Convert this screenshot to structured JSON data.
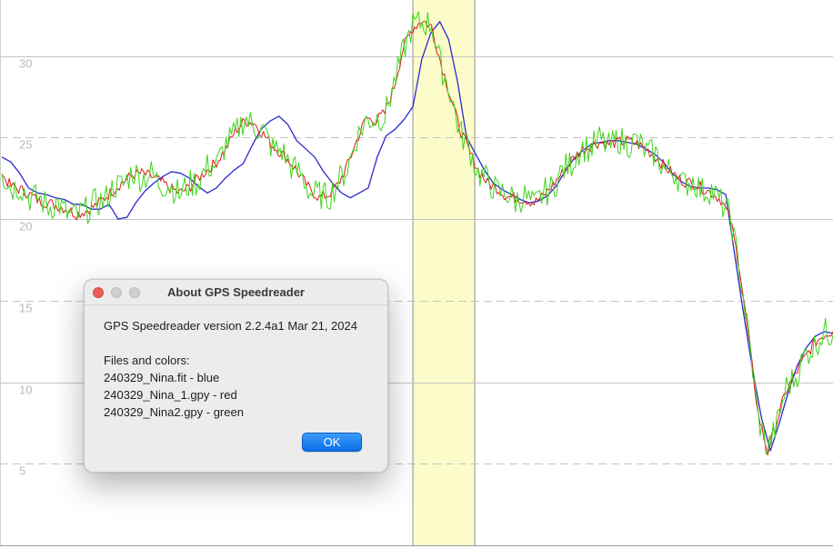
{
  "chart_data": {
    "type": "line",
    "title": "",
    "xlabel": "",
    "ylabel": "",
    "ylim": [
      0,
      33.2
    ],
    "y_ticks": [
      {
        "label": "30",
        "value": 30
      },
      {
        "label": "25",
        "value": 25
      },
      {
        "label": "20",
        "value": 20
      },
      {
        "label": "15",
        "value": 15
      },
      {
        "label": "10",
        "value": 10
      },
      {
        "label": "5",
        "value": 5
      }
    ],
    "grid": "horizontal lines; solid at 10, 20, 30 and dashed at 5, 15, 25",
    "highlighted_range": {
      "color": "#fcfccb"
    },
    "series": [
      {
        "color": "#2a2ad0",
        "points": [
          [
            0,
            23.8
          ],
          [
            1,
            23.5
          ],
          [
            2,
            22.8
          ],
          [
            3,
            21.9
          ],
          [
            4,
            21.6
          ],
          [
            5,
            21.5
          ],
          [
            6,
            21.3
          ],
          [
            7,
            21.2
          ],
          [
            8,
            20.9
          ],
          [
            9,
            20.9
          ],
          [
            10,
            20.6
          ],
          [
            11,
            20.6
          ],
          [
            12,
            20.9
          ],
          [
            13,
            20.0
          ],
          [
            14,
            20.1
          ],
          [
            15,
            21.0
          ],
          [
            16,
            21.7
          ],
          [
            17,
            22.2
          ],
          [
            18,
            22.6
          ],
          [
            19,
            22.9
          ],
          [
            20,
            22.8
          ],
          [
            21,
            22.5
          ],
          [
            22,
            22.0
          ],
          [
            23,
            21.6
          ],
          [
            24,
            21.9
          ],
          [
            25,
            22.5
          ],
          [
            26,
            23.0
          ],
          [
            27,
            23.4
          ],
          [
            28,
            24.5
          ],
          [
            29,
            25.5
          ],
          [
            30,
            26.0
          ],
          [
            31,
            26.3
          ],
          [
            32,
            25.8
          ],
          [
            33,
            24.8
          ],
          [
            34,
            24.3
          ],
          [
            35,
            23.8
          ],
          [
            36,
            22.9
          ],
          [
            37,
            22.2
          ],
          [
            38,
            21.6
          ],
          [
            39,
            21.3
          ],
          [
            40,
            21.6
          ],
          [
            41,
            21.9
          ],
          [
            42,
            23.8
          ],
          [
            43,
            25.1
          ],
          [
            44,
            25.5
          ],
          [
            45,
            26.1
          ],
          [
            46,
            26.9
          ],
          [
            47,
            29.8
          ],
          [
            48,
            31.4
          ],
          [
            49,
            32.1
          ],
          [
            50,
            31.0
          ],
          [
            51,
            28.4
          ],
          [
            52,
            25.0
          ],
          [
            53,
            24.0
          ],
          [
            54,
            23.0
          ],
          [
            55,
            22.2
          ],
          [
            56,
            21.8
          ],
          [
            57,
            21.5
          ],
          [
            58,
            21.2
          ],
          [
            59,
            21.0
          ],
          [
            60,
            21.1
          ],
          [
            61,
            21.4
          ],
          [
            62,
            22.0
          ],
          [
            63,
            22.9
          ],
          [
            64,
            23.7
          ],
          [
            65,
            24.2
          ],
          [
            66,
            24.6
          ],
          [
            67,
            24.7
          ],
          [
            68,
            24.8
          ],
          [
            69,
            24.8
          ],
          [
            70,
            24.7
          ],
          [
            71,
            24.6
          ],
          [
            72,
            24.3
          ],
          [
            73,
            24.0
          ],
          [
            74,
            23.5
          ],
          [
            75,
            22.8
          ],
          [
            76,
            22.3
          ],
          [
            77,
            22.0
          ],
          [
            78,
            21.9
          ],
          [
            79,
            21.9
          ],
          [
            80,
            21.8
          ],
          [
            81,
            21.5
          ],
          [
            82,
            17.8
          ],
          [
            83,
            14.2
          ],
          [
            84,
            10.8
          ],
          [
            85,
            7.8
          ],
          [
            86,
            5.8
          ],
          [
            87,
            7.5
          ],
          [
            88,
            9.4
          ],
          [
            89,
            11.0
          ],
          [
            90,
            12.1
          ],
          [
            91,
            12.8
          ],
          [
            92,
            13.1
          ],
          [
            93,
            13.0
          ]
        ]
      },
      {
        "color": "#dd1c1c",
        "points": [
          [
            0,
            22.7
          ],
          [
            1,
            22.0
          ],
          [
            2,
            21.8
          ],
          [
            3,
            21.5
          ],
          [
            4,
            21.1
          ],
          [
            5,
            21.0
          ],
          [
            6,
            20.8
          ],
          [
            7,
            20.6
          ],
          [
            8,
            20.3
          ],
          [
            9,
            20.5
          ],
          [
            10,
            20.8
          ],
          [
            11,
            21.3
          ],
          [
            12,
            21.8
          ],
          [
            13,
            22.3
          ],
          [
            14,
            22.7
          ],
          [
            15,
            22.8
          ],
          [
            16,
            22.6
          ],
          [
            17,
            22.3
          ],
          [
            18,
            21.9
          ],
          [
            19,
            21.6
          ],
          [
            20,
            21.9
          ],
          [
            21,
            22.5
          ],
          [
            22,
            23.0
          ],
          [
            23,
            23.5
          ],
          [
            24,
            24.3
          ],
          [
            25,
            25.4
          ],
          [
            26,
            26.0
          ],
          [
            27,
            25.9
          ],
          [
            28,
            25.2
          ],
          [
            29,
            24.5
          ],
          [
            30,
            24.0
          ],
          [
            31,
            23.4
          ],
          [
            32,
            22.6
          ],
          [
            33,
            21.8
          ],
          [
            34,
            21.3
          ],
          [
            35,
            21.5
          ],
          [
            36,
            22.1
          ],
          [
            37,
            23.3
          ],
          [
            38,
            24.8
          ],
          [
            39,
            26.2
          ],
          [
            40,
            26.0
          ],
          [
            41,
            26.5
          ],
          [
            42,
            28.1
          ],
          [
            43,
            30.5
          ],
          [
            44,
            31.7
          ],
          [
            45,
            32.2
          ],
          [
            46,
            31.8
          ],
          [
            47,
            29.6
          ],
          [
            48,
            27.6
          ],
          [
            49,
            25.6
          ],
          [
            50,
            24.2
          ],
          [
            51,
            23.0
          ],
          [
            52,
            22.2
          ],
          [
            53,
            21.9
          ],
          [
            54,
            21.4
          ],
          [
            55,
            21.3
          ],
          [
            56,
            21.2
          ],
          [
            57,
            21.0
          ],
          [
            58,
            21.4
          ],
          [
            59,
            22.1
          ],
          [
            60,
            22.8
          ],
          [
            61,
            23.6
          ],
          [
            62,
            24.2
          ],
          [
            63,
            24.5
          ],
          [
            64,
            24.7
          ],
          [
            65,
            24.6
          ],
          [
            66,
            24.7
          ],
          [
            67,
            24.8
          ],
          [
            68,
            24.6
          ],
          [
            69,
            24.3
          ],
          [
            70,
            23.8
          ],
          [
            71,
            23.2
          ],
          [
            72,
            22.7
          ],
          [
            73,
            22.3
          ],
          [
            74,
            22.2
          ],
          [
            75,
            21.9
          ],
          [
            76,
            21.6
          ],
          [
            77,
            21.2
          ],
          [
            78,
            20.0
          ],
          [
            79,
            17.0
          ],
          [
            80,
            12.5
          ],
          [
            81,
            8.0
          ],
          [
            82,
            5.7
          ],
          [
            83,
            7.6
          ],
          [
            84,
            9.5
          ],
          [
            85,
            10.5
          ],
          [
            86,
            11.5
          ],
          [
            87,
            12.4
          ],
          [
            88,
            12.9
          ],
          [
            89,
            13.1
          ]
        ]
      },
      {
        "color": "#3fd418",
        "points": [
          [
            0,
            22.8
          ],
          [
            1,
            21.9
          ],
          [
            2,
            22.0
          ],
          [
            3,
            21.3
          ],
          [
            4,
            21.3
          ],
          [
            5,
            20.7
          ],
          [
            6,
            21.0
          ],
          [
            7,
            20.3
          ],
          [
            8,
            20.2
          ],
          [
            9,
            20.5
          ],
          [
            10,
            21.0
          ],
          [
            11,
            21.1
          ],
          [
            12,
            22.0
          ],
          [
            13,
            22.1
          ],
          [
            14,
            22.9
          ],
          [
            15,
            22.5
          ],
          [
            16,
            22.8
          ],
          [
            17,
            22.1
          ],
          [
            18,
            22.1
          ],
          [
            19,
            21.5
          ],
          [
            20,
            22.1
          ],
          [
            21,
            22.3
          ],
          [
            22,
            23.2
          ],
          [
            23,
            23.3
          ],
          [
            24,
            24.6
          ],
          [
            25,
            25.2
          ],
          [
            26,
            26.2
          ],
          [
            27,
            25.7
          ],
          [
            28,
            25.4
          ],
          [
            29,
            24.3
          ],
          [
            30,
            24.2
          ],
          [
            31,
            23.2
          ],
          [
            32,
            22.8
          ],
          [
            33,
            21.6
          ],
          [
            34,
            21.5
          ],
          [
            35,
            21.3
          ],
          [
            36,
            22.3
          ],
          [
            37,
            23.1
          ],
          [
            38,
            25.0
          ],
          [
            39,
            26.0
          ],
          [
            40,
            26.2
          ],
          [
            41,
            26.3
          ],
          [
            42,
            28.3
          ],
          [
            43,
            30.3
          ],
          [
            44,
            31.9
          ],
          [
            45,
            32.0
          ],
          [
            46,
            32.0
          ],
          [
            47,
            29.4
          ],
          [
            48,
            27.8
          ],
          [
            49,
            25.4
          ],
          [
            50,
            24.4
          ],
          [
            51,
            22.8
          ],
          [
            52,
            22.4
          ],
          [
            53,
            21.7
          ],
          [
            54,
            21.6
          ],
          [
            55,
            21.1
          ],
          [
            56,
            21.4
          ],
          [
            57,
            20.8
          ],
          [
            58,
            21.6
          ],
          [
            59,
            21.9
          ],
          [
            60,
            23.0
          ],
          [
            61,
            23.4
          ],
          [
            62,
            24.4
          ],
          [
            63,
            24.3
          ],
          [
            64,
            24.9
          ],
          [
            65,
            24.4
          ],
          [
            66,
            24.9
          ],
          [
            67,
            24.6
          ],
          [
            68,
            24.8
          ],
          [
            69,
            24.1
          ],
          [
            70,
            24.0
          ],
          [
            71,
            23.0
          ],
          [
            72,
            22.9
          ],
          [
            73,
            22.1
          ],
          [
            74,
            22.4
          ],
          [
            75,
            21.7
          ],
          [
            76,
            21.8
          ],
          [
            77,
            21.0
          ],
          [
            78,
            20.2
          ],
          [
            79,
            16.8
          ],
          [
            80,
            12.7
          ],
          [
            81,
            7.8
          ],
          [
            82,
            5.9
          ],
          [
            83,
            7.4
          ],
          [
            84,
            9.7
          ],
          [
            85,
            10.3
          ],
          [
            86,
            11.7
          ],
          [
            87,
            12.2
          ],
          [
            88,
            13.1
          ],
          [
            89,
            12.9
          ]
        ]
      }
    ]
  },
  "dialog": {
    "title": "About GPS Speedreader",
    "version_line": "GPS Speedreader version 2.2.4a1 Mar 21, 2024",
    "files_heading": "Files and colors:",
    "files": [
      "240329_Nina.fit - blue",
      "240329_Nina_1.gpy - red",
      "240329_Nina2.gpy - green"
    ],
    "ok_label": "OK"
  }
}
